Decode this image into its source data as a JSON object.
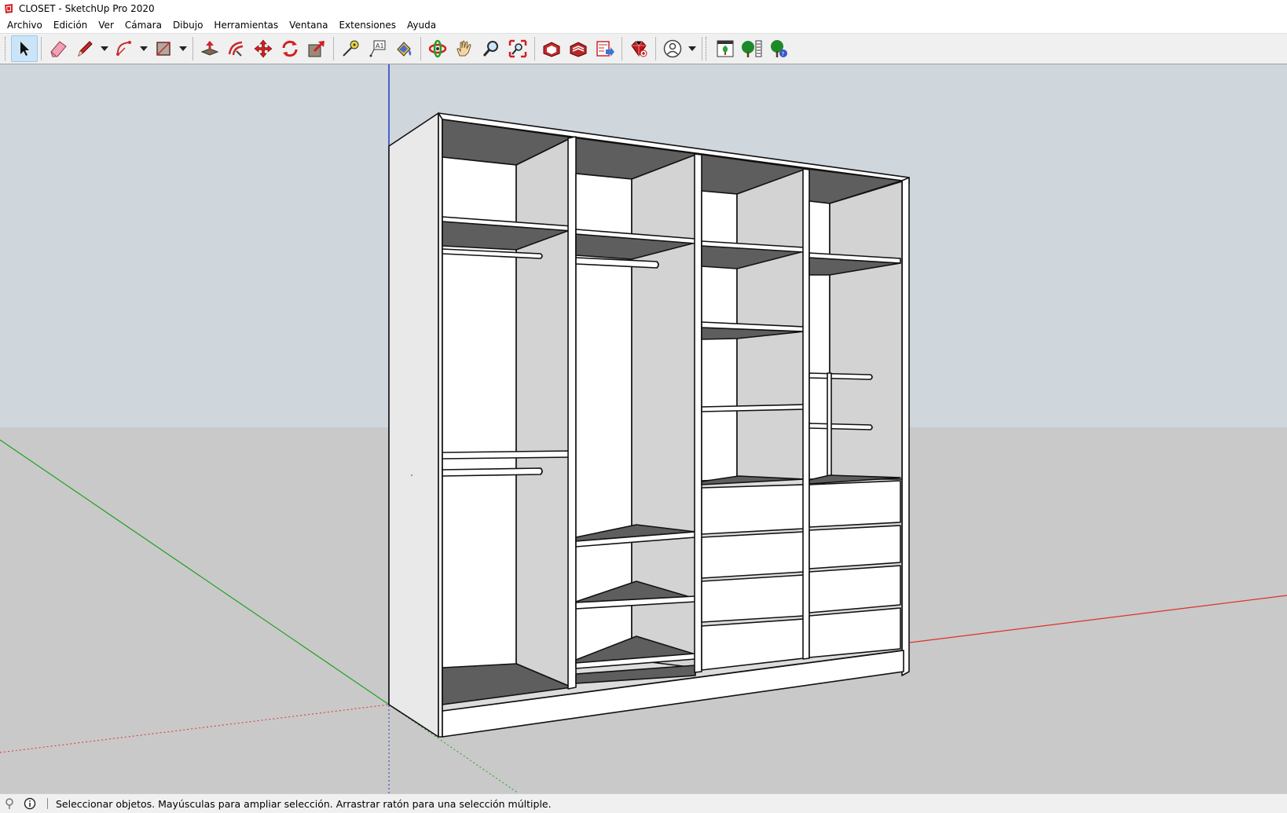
{
  "window": {
    "title": "CLOSET - SketchUp Pro 2020"
  },
  "menu": {
    "items": [
      "Archivo",
      "Edición",
      "Ver",
      "Cámara",
      "Dibujo",
      "Herramientas",
      "Ventana",
      "Extensiones",
      "Ayuda"
    ]
  },
  "toolbar": {
    "tools": [
      {
        "name": "select-tool",
        "icon": "arrow-cursor-icon",
        "active": true
      },
      {
        "name": "eraser-tool",
        "icon": "eraser-icon"
      },
      {
        "name": "line-tool",
        "icon": "pencil-icon",
        "dropdown": true
      },
      {
        "name": "arc-tool",
        "icon": "arc-icon",
        "dropdown": true
      },
      {
        "name": "rectangle-tool",
        "icon": "rectangle-icon",
        "dropdown": true
      },
      {
        "name": "push-pull-tool",
        "icon": "push-pull-icon"
      },
      {
        "name": "offset-tool",
        "icon": "offset-icon"
      },
      {
        "name": "move-tool",
        "icon": "move-icon"
      },
      {
        "name": "rotate-tool",
        "icon": "rotate-icon"
      },
      {
        "name": "scale-tool",
        "icon": "scale-icon"
      },
      {
        "name": "tape-measure-tool",
        "icon": "tape-measure-icon"
      },
      {
        "name": "text-tool",
        "icon": "text-icon"
      },
      {
        "name": "paint-bucket-tool",
        "icon": "paint-bucket-icon"
      },
      {
        "name": "orbit-tool",
        "icon": "orbit-icon"
      },
      {
        "name": "pan-tool",
        "icon": "hand-icon"
      },
      {
        "name": "zoom-tool",
        "icon": "magnifier-icon"
      },
      {
        "name": "zoom-extents-tool",
        "icon": "zoom-extents-icon"
      },
      {
        "name": "warehouse-tool",
        "icon": "warehouse-icon"
      },
      {
        "name": "extension-warehouse-tool",
        "icon": "extension-warehouse-icon"
      },
      {
        "name": "send-to-layout-tool",
        "icon": "layout-icon"
      },
      {
        "name": "ruby-console-tool",
        "icon": "ruby-gem-icon"
      },
      {
        "name": "account-tool",
        "icon": "user-circle-icon",
        "dropdown": true
      },
      {
        "name": "component-browser-tool",
        "icon": "component-window-icon"
      },
      {
        "name": "tree-tool",
        "icon": "tree-icon"
      },
      {
        "name": "tree-settings-tool",
        "icon": "tree-badge-icon"
      }
    ]
  },
  "statusbar": {
    "message": "Seleccionar objetos. Mayúsculas para ampliar selección. Arrastrar ratón para una selección múltiple."
  },
  "colors": {
    "sky": "#cdd5dc",
    "ground": "#c8c8c8",
    "panel_white": "#ffffff",
    "panel_light": "#d3d3d3",
    "panel_dark": "#5e5e5e",
    "axis_red": "#e0302a",
    "axis_green": "#22a022",
    "axis_blue": "#1e3cc8"
  }
}
